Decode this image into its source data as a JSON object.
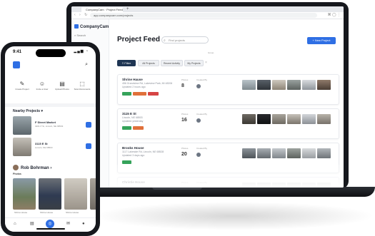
{
  "browser": {
    "tab_title": "CompanyCam · Project Feed",
    "url": "app.companycam.com/projects",
    "nav": "‹ › ↻",
    "ext": "⌘ ◯ ⋮"
  },
  "sidebar": {
    "brand": "CompanyCam",
    "search": "Search"
  },
  "project_feed": {
    "title": "Project Feed",
    "search_placeholder": "Find projects",
    "new_button": "+ New Project",
    "filter_caption": "Group",
    "filter_button": "Filter",
    "chips": [
      "All Projects",
      "Recent Activity",
      "My Projects"
    ],
    "cards": [
      {
        "name": "Shrine Hause",
        "addr1": "456 Grandview Rd, Lakeview Park, MI 48206",
        "addr2": "Updated 2 hours ago",
        "photos_label": "Photos",
        "count": "8",
        "created_label": "Created By",
        "tags": [
          {
            "color": "#35a35a"
          },
          {
            "color": "#e0703a"
          },
          {
            "color": "#d64545"
          }
        ]
      },
      {
        "name": "3115 E St",
        "addr1": "Lincoln, NE 68503",
        "addr2": "Updated yesterday",
        "photos_label": "Photos",
        "count": "16",
        "created_label": "Created By",
        "tags": [
          {
            "color": "#35a35a"
          },
          {
            "color": "#e0703a"
          }
        ]
      },
      {
        "name": "Brooks House",
        "addr1": "1117 Lakeside Rd, Lincoln, NE 68528",
        "addr2": "Updated 3 days ago",
        "photos_label": "Photos",
        "count": "20",
        "created_label": "Created By",
        "tags": [
          {
            "color": "#35a35a"
          }
        ]
      },
      {
        "name": "Christie House",
        "addr1": "",
        "addr2": "",
        "photos_label": "Photos",
        "count": "",
        "created_label": "Created By",
        "tags": []
      }
    ]
  },
  "phone": {
    "time": "9:41",
    "status_icons": "▂▄▆ ◔",
    "quick_actions": [
      {
        "icon": "✎",
        "label": "Create Project"
      },
      {
        "icon": "☺",
        "label": "Invite a User"
      },
      {
        "icon": "▤",
        "label": "Upload Photos"
      },
      {
        "icon": "⬚",
        "label": "Scan Documents"
      }
    ],
    "nearby_title": "Nearby Projects ▾",
    "nearby": [
      {
        "name": "F Street Market",
        "sub": "3201 P St, Lincoln, NE 68503"
      },
      {
        "name": "3115 E St",
        "sub": "Lincoln, NE 68503"
      }
    ],
    "user_name": "Rob Bohrman ›",
    "photos_caption": "Photos",
    "user_photos": [
      {
        "caption": "Shrine House"
      },
      {
        "caption": "Shrine House"
      },
      {
        "caption": "Shrine House"
      }
    ],
    "tab_icons": [
      "⌂",
      "▤",
      "◎",
      "✉",
      "●"
    ]
  },
  "colors": {
    "accent": "#2f6fe4",
    "filter_bg": "#1e3553",
    "device": "#16181d"
  }
}
